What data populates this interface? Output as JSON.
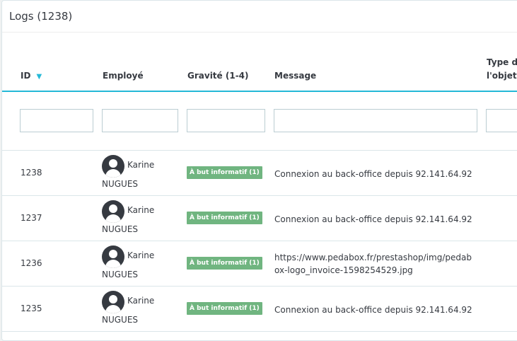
{
  "panel": {
    "title": "Logs (1238)"
  },
  "table": {
    "headers": {
      "id": "ID",
      "employee": "Employé",
      "severity": "Gravité (1-4)",
      "message": "Message",
      "object_type_line1": "Type de",
      "object_type_line2": "l'objet"
    },
    "filters": {
      "id": "",
      "employee": "",
      "severity": "",
      "message": "",
      "object_type": ""
    },
    "rows": [
      {
        "id": "1238",
        "employee_first": "Karine",
        "employee_last": "NUGUES",
        "severity": "À but informatif (1)",
        "message": "Connexion au back-office depuis 92.141.64.92"
      },
      {
        "id": "1237",
        "employee_first": "Karine",
        "employee_last": "NUGUES",
        "severity": "À but informatif (1)",
        "message": "Connexion au back-office depuis 92.141.64.92"
      },
      {
        "id": "1236",
        "employee_first": "Karine",
        "employee_last": "NUGUES",
        "severity": "À but informatif (1)",
        "message_line1": "https://www.pedabox.fr/prestashop/img/pedab",
        "message_line2": "ox-logo_invoice-1598254529.jpg"
      },
      {
        "id": "1235",
        "employee_first": "Karine",
        "employee_last": "NUGUES",
        "severity": "À but informatif (1)",
        "message": "Connexion au back-office depuis 92.141.64.92"
      }
    ]
  },
  "colors": {
    "accent": "#25b9d7",
    "badge": "#70b580",
    "text": "#363a41",
    "border": "#dbe6e9"
  },
  "icons": {
    "sort": "chevron-down-icon",
    "avatar": "user-avatar-icon"
  }
}
